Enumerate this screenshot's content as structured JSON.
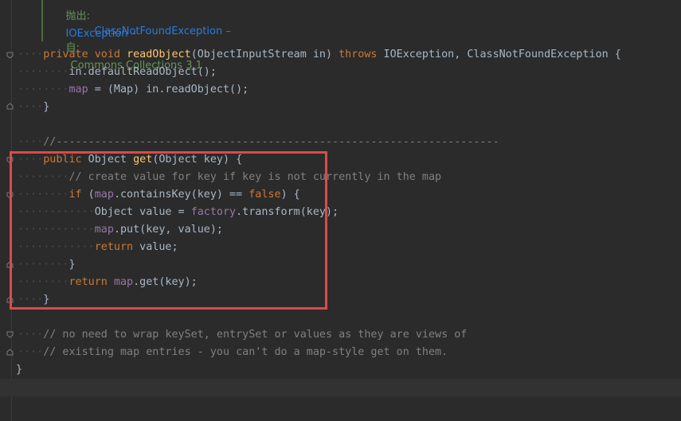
{
  "doc": {
    "throws_label": "抛出:",
    "throws_1": "IOException –",
    "throws_2": "ClassNotFoundException –",
    "since_label": "自:",
    "since_value": "Commons Collections 3.1"
  },
  "code": {
    "l1": {
      "kw1": "private",
      "kw2": "void",
      "fn": "readObject",
      "rest1": "(ObjectInputStream in) ",
      "kw3": "throws",
      "rest2": " IOException, ClassNotFoundException {"
    },
    "l2": {
      "text": "in.defaultReadObject();"
    },
    "l3": {
      "field": "map",
      "rest": " = (Map) in.readObject();"
    },
    "l4": {
      "text": "}"
    },
    "l5": {
      "cmt": "//---------------------------------------------------------------------"
    },
    "l6": {
      "kw": "public",
      "rest1": " Object ",
      "fn": "get",
      "rest2": "(Object key) {"
    },
    "l7": {
      "cmt": "// create value for key if key is not currently in the map"
    },
    "l8": {
      "kw": "if",
      "rest1": " (",
      "field": "map",
      "rest2": ".containsKey(key) == ",
      "kw2": "false",
      "rest3": ") {"
    },
    "l9": {
      "rest1": "Object value = ",
      "field": "factory",
      "rest2": ".transform(key);"
    },
    "l10": {
      "field": "map",
      "rest": ".put(key, value);"
    },
    "l11": {
      "kw": "return",
      "rest": " value;"
    },
    "l12": {
      "text": "}"
    },
    "l13": {
      "kw": "return",
      "rest1": " ",
      "field": "map",
      "rest2": ".get(key);"
    },
    "l14": {
      "text": "}"
    },
    "l15": {
      "cmt": "// no need to wrap keySet, entrySet or values as they are views of"
    },
    "l16": {
      "cmt": "// existing map entries - you can't do a map-style get on them."
    },
    "l17": {
      "text": "}"
    }
  },
  "colors": {
    "background": "#2b2b2b",
    "keyword": "#cc7832",
    "method": "#ffc66d",
    "field": "#9876aa",
    "comment": "#808080",
    "highlight": "#e0484a"
  }
}
